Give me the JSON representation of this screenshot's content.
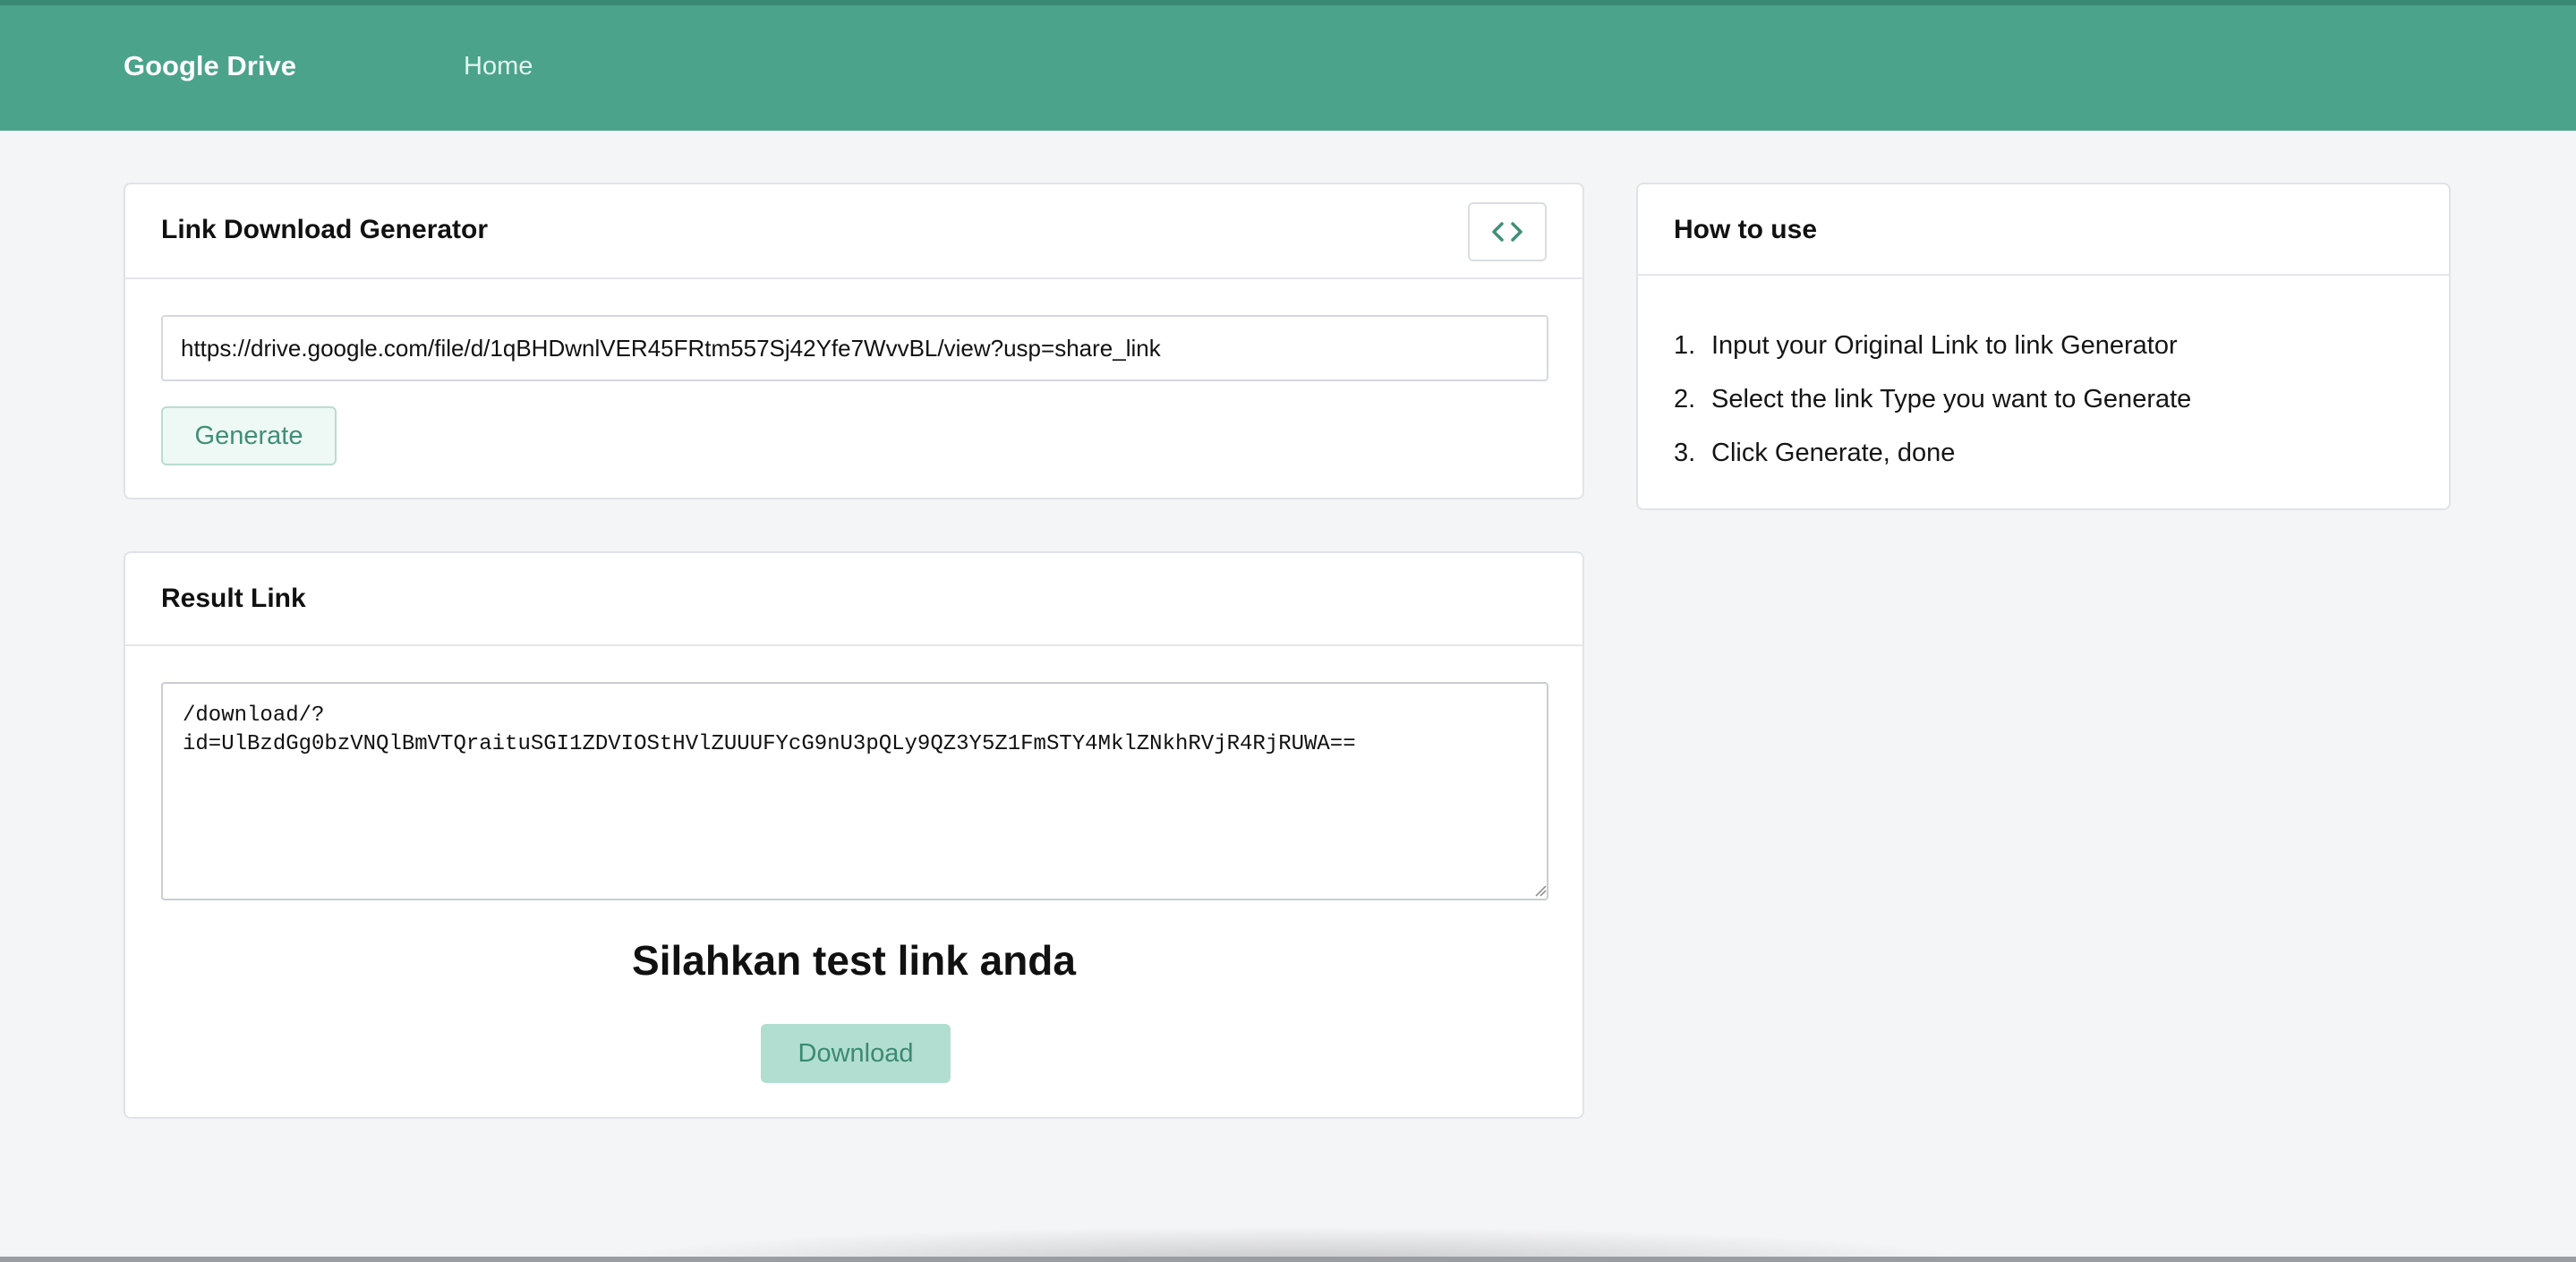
{
  "navbar": {
    "brand": "Google Drive",
    "home": "Home",
    "bg_color": "#4aa38a"
  },
  "generator": {
    "title": "Link Download Generator",
    "toggle_icon": "code-icon",
    "input_value": "https://drive.google.com/file/d/1qBHDwnlVER45FRtm557Sj42Yfe7WvvBL/view?usp=share_link",
    "generate_label": "Generate"
  },
  "howto": {
    "title": "How to use",
    "steps": [
      {
        "num": "1.",
        "text": "Input your Original Link to link Generator"
      },
      {
        "num": "2.",
        "text": "Select the link Type you want to Generate"
      },
      {
        "num": "3.",
        "text": "Click Generate, done"
      }
    ]
  },
  "result": {
    "title": "Result Link",
    "link_value": "/download/?\nid=UlBzdGg0bzVNQlBmVTQraituSGI1ZDVIOStHVlZUUUFYcG9nU3pQLy9QZ3Y5Z1FmSTY4MklZNkhRVjR4RjRUWA==",
    "test_heading": "Silahkan test link anda",
    "download_label": "Download"
  },
  "colors": {
    "accent": "#4aa38a",
    "accent_dark": "#3a8a73",
    "button_light": "#eef8f4",
    "download_bg": "#b2ded1"
  }
}
